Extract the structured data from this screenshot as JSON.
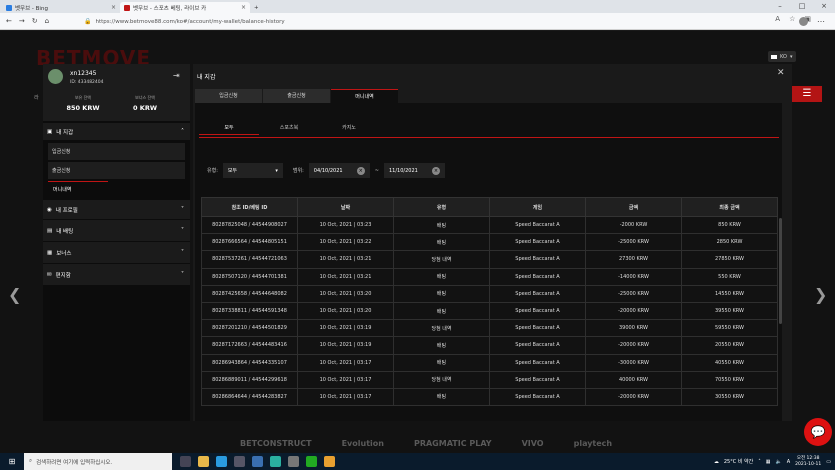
{
  "browser": {
    "tabs": [
      {
        "label": "벳무브 - Bing",
        "color": "#2a7de1"
      },
      {
        "label": "벳무브 - 스포츠 베팅, 라이브 카",
        "color": "#c01515"
      }
    ],
    "url": "https://www.betmove88.com/ko#/account/my-wallet/balance-history"
  },
  "site": {
    "logo": "BETMOVE",
    "lang": "KO",
    "peek": "라"
  },
  "account": {
    "username": "xn12345",
    "id_label": "ID: 433482404",
    "balances": [
      {
        "label": "보유 잔액",
        "value": "850 KRW"
      },
      {
        "label": "보너스 잔액",
        "value": "0 KRW"
      }
    ],
    "sections": {
      "wallet": "내 지갑",
      "subs": [
        "입금신청",
        "출금신청",
        "머니내역"
      ],
      "others": [
        "내 프로필",
        "내 배팅",
        "보너스",
        "편지함"
      ]
    }
  },
  "panel": {
    "title": "내 지갑",
    "tabs": [
      "입금신청",
      "출금신청",
      "머니내역"
    ],
    "subtabs": [
      "모두",
      "스포츠북",
      "카지노"
    ],
    "filter_type_label": "유형:",
    "filter_type_value": "모두",
    "range_label": "범위:",
    "date_from": "04/10/2021",
    "date_sep": "~",
    "date_to": "11/10/2021"
  },
  "table": {
    "headers": [
      "참조 ID/베팅 ID",
      "날짜",
      "유형",
      "게임",
      "금액",
      "최종 금액"
    ],
    "rows": [
      [
        "80287825048 / 44544908027",
        "10 Oct, 2021 | 03:23",
        "배팅",
        "Speed Baccarat A",
        "-2000 KRW",
        "850 KRW"
      ],
      [
        "80287666564 / 44544805151",
        "10 Oct, 2021 | 03:22",
        "배팅",
        "Speed Baccarat A",
        "-25000 KRW",
        "2850 KRW"
      ],
      [
        "80287537261 / 44544721063",
        "10 Oct, 2021 | 03:21",
        "당첨 내역",
        "Speed Baccarat A",
        "27300 KRW",
        "27850 KRW"
      ],
      [
        "80287507120 / 44544701381",
        "10 Oct, 2021 | 03:21",
        "배팅",
        "Speed Baccarat A",
        "-14000 KRW",
        "550 KRW"
      ],
      [
        "80287425658 / 44544648082",
        "10 Oct, 2021 | 03:20",
        "배팅",
        "Speed Baccarat A",
        "-25000 KRW",
        "14550 KRW"
      ],
      [
        "80287338811 / 44544591348",
        "10 Oct, 2021 | 03:20",
        "배팅",
        "Speed Baccarat A",
        "-20000 KRW",
        "39550 KRW"
      ],
      [
        "80287201210 / 44544501829",
        "10 Oct, 2021 | 03:19",
        "당첨 내역",
        "Speed Baccarat A",
        "39000 KRW",
        "59550 KRW"
      ],
      [
        "80287172663 / 44544483416",
        "10 Oct, 2021 | 03:19",
        "배팅",
        "Speed Baccarat A",
        "-20000 KRW",
        "20550 KRW"
      ],
      [
        "80286943864 / 44544335107",
        "10 Oct, 2021 | 03:17",
        "배팅",
        "Speed Baccarat A",
        "-30000 KRW",
        "40550 KRW"
      ],
      [
        "80286889011 / 44544299618",
        "10 Oct, 2021 | 03:17",
        "당첨 내역",
        "Speed Baccarat A",
        "40000 KRW",
        "70550 KRW"
      ],
      [
        "80286864644 / 44544283827",
        "10 Oct, 2021 | 03:17",
        "배팅",
        "Speed Baccarat A",
        "-20000 KRW",
        "30550 KRW"
      ]
    ]
  },
  "partners": [
    "BETCONSTRUCT",
    "Evolution",
    "PRAGMATIC PLAY",
    "VIVO",
    "playtech"
  ],
  "taskbar": {
    "search_placeholder": "검색하려면 여기에 입력하십시오.",
    "weather": "25°C 비 약간",
    "time": "오전 12:38",
    "date": "2021-10-11"
  }
}
